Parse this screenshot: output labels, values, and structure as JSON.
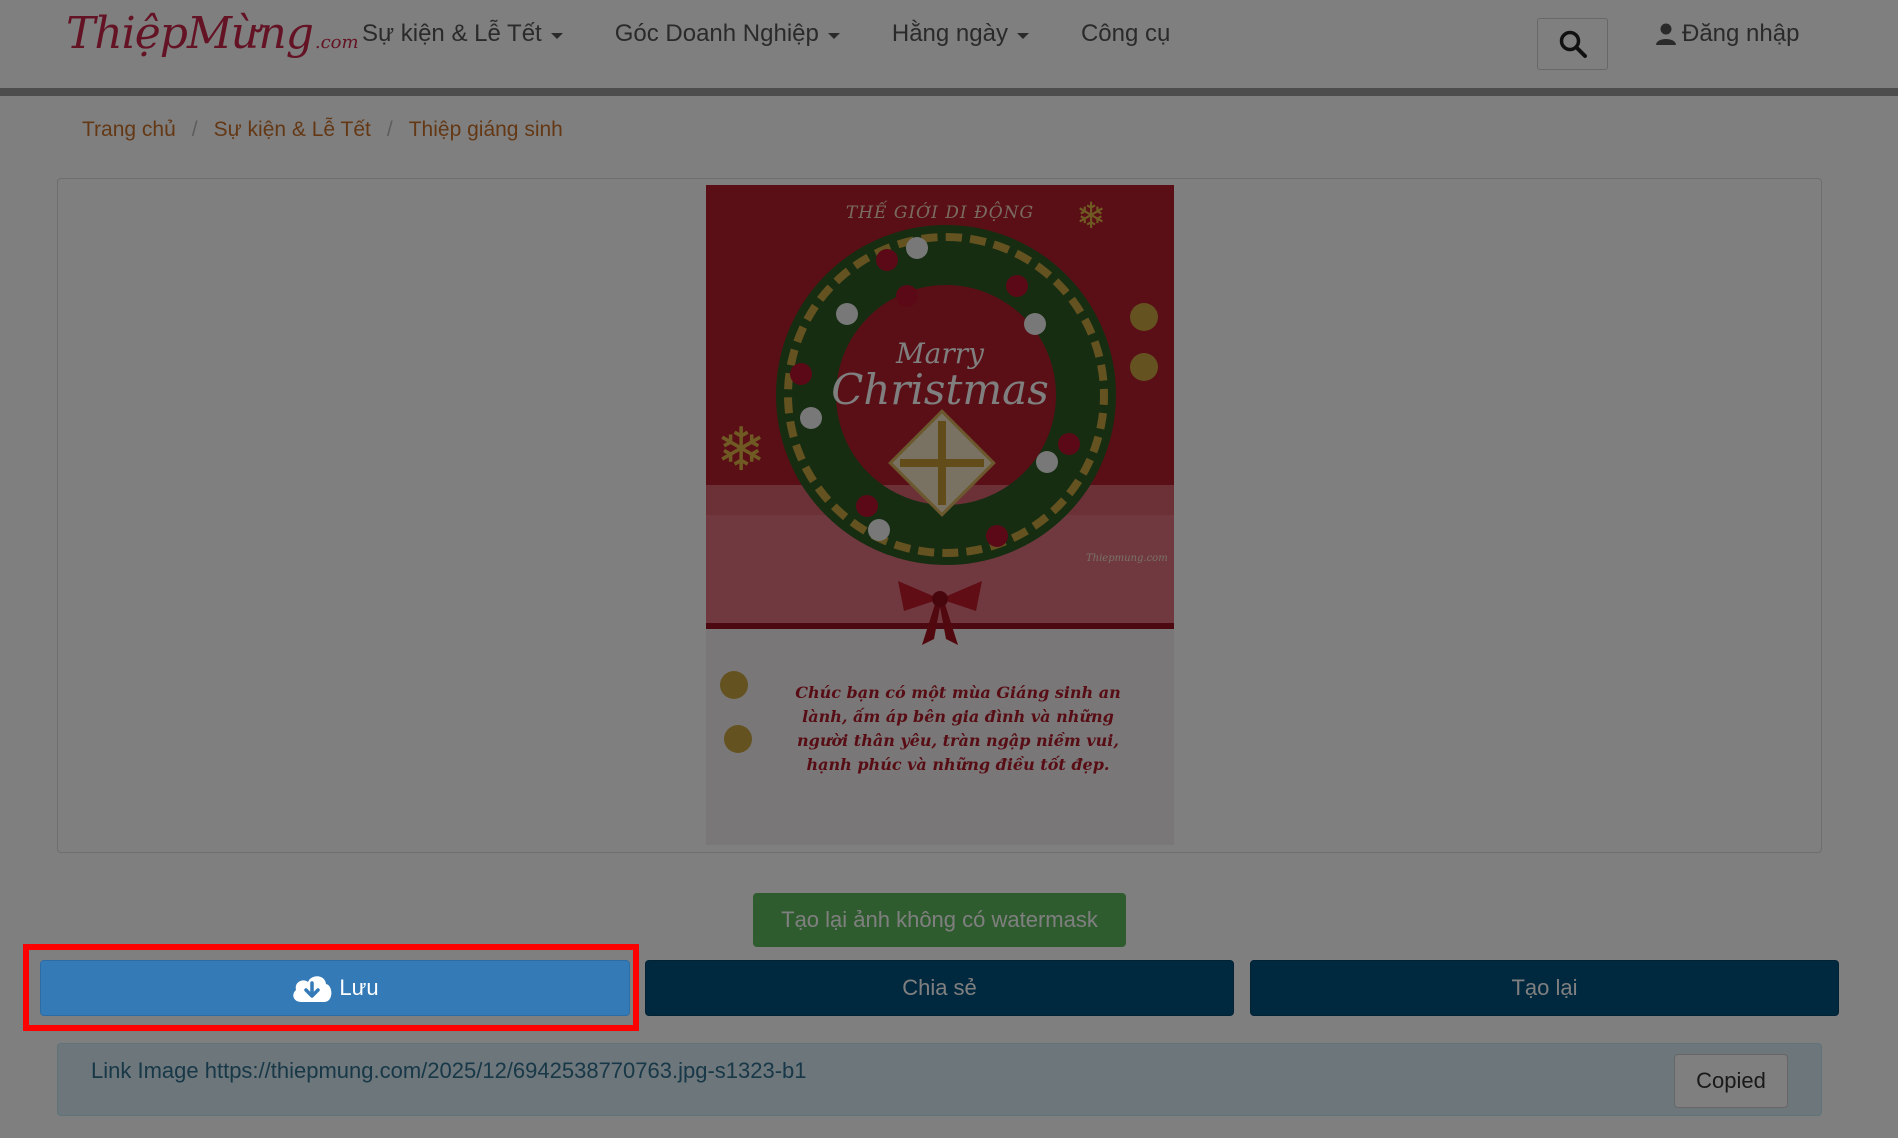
{
  "header": {
    "logo_text": "ThiệpMừng",
    "logo_domain": ".com",
    "nav": [
      {
        "label": "Sự kiện & Lễ Tết",
        "has_dropdown": true
      },
      {
        "label": "Góc Doanh Nghiệp",
        "has_dropdown": true
      },
      {
        "label": "Hằng ngày",
        "has_dropdown": true
      },
      {
        "label": "Công cụ",
        "has_dropdown": false
      }
    ],
    "search_icon": "search-icon",
    "login_label": "Đăng nhập"
  },
  "breadcrumb": {
    "items": [
      "Trang chủ",
      "Sự kiện & Lễ Tết",
      "Thiệp giáng sinh"
    ],
    "separator": "/"
  },
  "card": {
    "top_text": "THẾ GIỚI DI ĐỘNG",
    "marry": "Marry",
    "christmas": "Christmas",
    "sign_text": "Thiepmung.com",
    "message": "Chúc bạn có một mùa Giáng sinh an lành, ấm áp bên gia đình và những người thân yêu, tràn ngập niềm vui, hạnh phúc và những điều tốt đẹp."
  },
  "buttons": {
    "regen_no_watermark": "Tạo lại ảnh không có watermask",
    "save": "Lưu",
    "share": "Chia sẻ",
    "redo": "Tạo lại"
  },
  "link_bar": {
    "text": "Link Image https://thiepmung.com/2025/12/6942538770763.jpg-s1323-b1",
    "copied_label": "Copied"
  },
  "colors": {
    "accent_orange": "#c8702a",
    "logo_red": "#c8264a",
    "green_button": "#5cb85c",
    "save_blue": "#337ab7",
    "dark_blue": "#00507e",
    "highlight_red": "#ff0000"
  }
}
